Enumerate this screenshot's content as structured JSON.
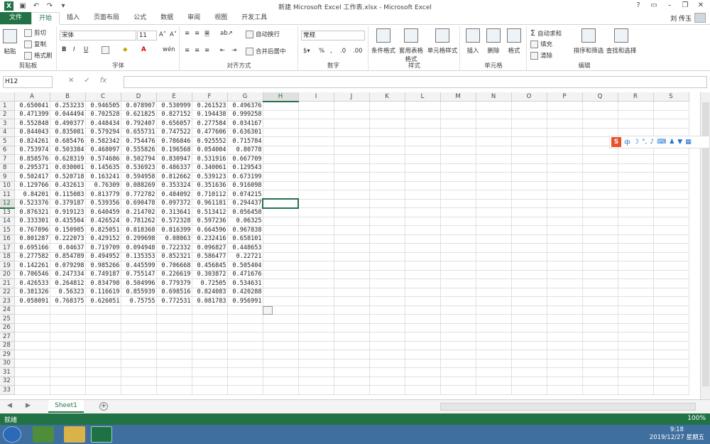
{
  "app": {
    "title": "新建 Microsoft Excel 工作表.xlsx - Microsoft Excel",
    "user": "刘 传玉"
  },
  "tabs": [
    "文件",
    "开始",
    "插入",
    "页面布局",
    "公式",
    "数据",
    "审阅",
    "视图",
    "开发工具"
  ],
  "ribbon": {
    "clipboard": {
      "label": "剪贴板",
      "paste": "粘贴",
      "cut": "剪切",
      "copy": "复制",
      "format_painter": "格式刷"
    },
    "font": {
      "label": "字体",
      "name": "宋体",
      "size": "11"
    },
    "alignment": {
      "label": "对齐方式",
      "wrap": "自动换行",
      "merge": "合并后居中"
    },
    "number": {
      "label": "数字",
      "format": "常规"
    },
    "styles": {
      "label": "样式",
      "conditional": "条件格式",
      "table": "套用表格格式",
      "cell_styles": "单元格样式"
    },
    "cells": {
      "label": "单元格",
      "insert": "插入",
      "delete": "删除",
      "format": "格式"
    },
    "editing": {
      "label": "编辑",
      "autosum": "自动求和",
      "fill": "填充",
      "clear": "清除",
      "sort": "排序和筛选",
      "find": "查找和选择"
    }
  },
  "formula_bar": {
    "name_box": "H12",
    "fx": "fx"
  },
  "columns": [
    "A",
    "B",
    "C",
    "D",
    "E",
    "F",
    "G",
    "H",
    "I",
    "J",
    "K",
    "L",
    "M",
    "N",
    "O",
    "P",
    "Q",
    "R",
    "S"
  ],
  "rows": [
    [
      "0.650041",
      "0.253233",
      "0.946505",
      "0.078907",
      "0.530999",
      "0.261523",
      "0.496376"
    ],
    [
      "0.471399",
      "0.044494",
      "0.702528",
      "0.621825",
      "0.827152",
      "0.194438",
      "0.999258"
    ],
    [
      "0.552848",
      "0.490377",
      "0.448434",
      "0.792407",
      "0.656057",
      "0.277584",
      "0.034167"
    ],
    [
      "0.844043",
      "0.835081",
      "0.579294",
      "0.655731",
      "0.747522",
      "0.477606",
      "0.636301"
    ],
    [
      "0.824261",
      "0.685476",
      "0.582342",
      "0.754476",
      "0.786846",
      "0.925552",
      "0.715784"
    ],
    [
      "0.753974",
      "0.503384",
      "0.468097",
      "0.555826",
      "0.196568",
      "0.054004",
      "0.80778"
    ],
    [
      "0.858576",
      "0.628319",
      "0.574686",
      "0.502794",
      "0.830947",
      "0.531916",
      "0.667709"
    ],
    [
      "0.295371",
      "0.030001",
      "0.145635",
      "0.536923",
      "0.486337",
      "0.340061",
      "0.129543"
    ],
    [
      "0.502417",
      "0.520718",
      "0.163241",
      "0.594958",
      "0.812662",
      "0.539123",
      "0.673199"
    ],
    [
      "0.129766",
      "0.432613",
      "0.76309",
      "0.088269",
      "0.353324",
      "0.351636",
      "0.916098"
    ],
    [
      "0.84201",
      "0.115083",
      "0.813779",
      "0.772782",
      "0.484092",
      "0.710112",
      "0.074215"
    ],
    [
      "0.523376",
      "0.379187",
      "0.539356",
      "0.690478",
      "0.097372",
      "0.961181",
      "0.294437"
    ],
    [
      "0.876321",
      "0.919123",
      "0.640459",
      "0.214702",
      "0.313641",
      "0.513412",
      "0.056458"
    ],
    [
      "0.333301",
      "0.435504",
      "0.426524",
      "0.781262",
      "0.572328",
      "0.597236",
      "0.06325"
    ],
    [
      "0.767896",
      "0.150985",
      "0.825051",
      "0.818368",
      "0.816399",
      "0.664596",
      "0.967838"
    ],
    [
      "0.801287",
      "0.222073",
      "0.429152",
      "0.299698",
      "0.08063",
      "0.232416",
      "0.658101"
    ],
    [
      "0.695166",
      "0.04637",
      "0.719709",
      "0.094948",
      "0.722332",
      "0.096827",
      "0.448653"
    ],
    [
      "0.277582",
      "0.854789",
      "0.494952",
      "0.135353",
      "0.852321",
      "0.586477",
      "0.22721"
    ],
    [
      "0.142261",
      "0.079298",
      "0.985266",
      "0.445599",
      "0.706668",
      "0.456845",
      "0.505404"
    ],
    [
      "0.706546",
      "0.247334",
      "0.749187",
      "0.755147",
      "0.226619",
      "0.303872",
      "0.471676"
    ],
    [
      "0.426533",
      "0.264812",
      "0.834798",
      "0.504996",
      "0.779379",
      "0.72505",
      "0.534631"
    ],
    [
      "0.381326",
      "0.56323",
      "0.116619",
      "0.855939",
      "0.698516",
      "0.824083",
      "0.420288"
    ],
    [
      "0.058091",
      "0.768375",
      "0.626051",
      "0.75755",
      "0.772531",
      "0.081783",
      "0.956991"
    ]
  ],
  "total_rows": 33,
  "sheet_tab": "Sheet1",
  "status": {
    "ready": "就绪",
    "zoom": "100%"
  },
  "ime": {
    "mode": "中"
  },
  "clock": {
    "time": "9:18",
    "date": "2019/12/27 星期五"
  },
  "colors": {
    "accent": "#217346",
    "taskbar": "#3f6f9f"
  }
}
